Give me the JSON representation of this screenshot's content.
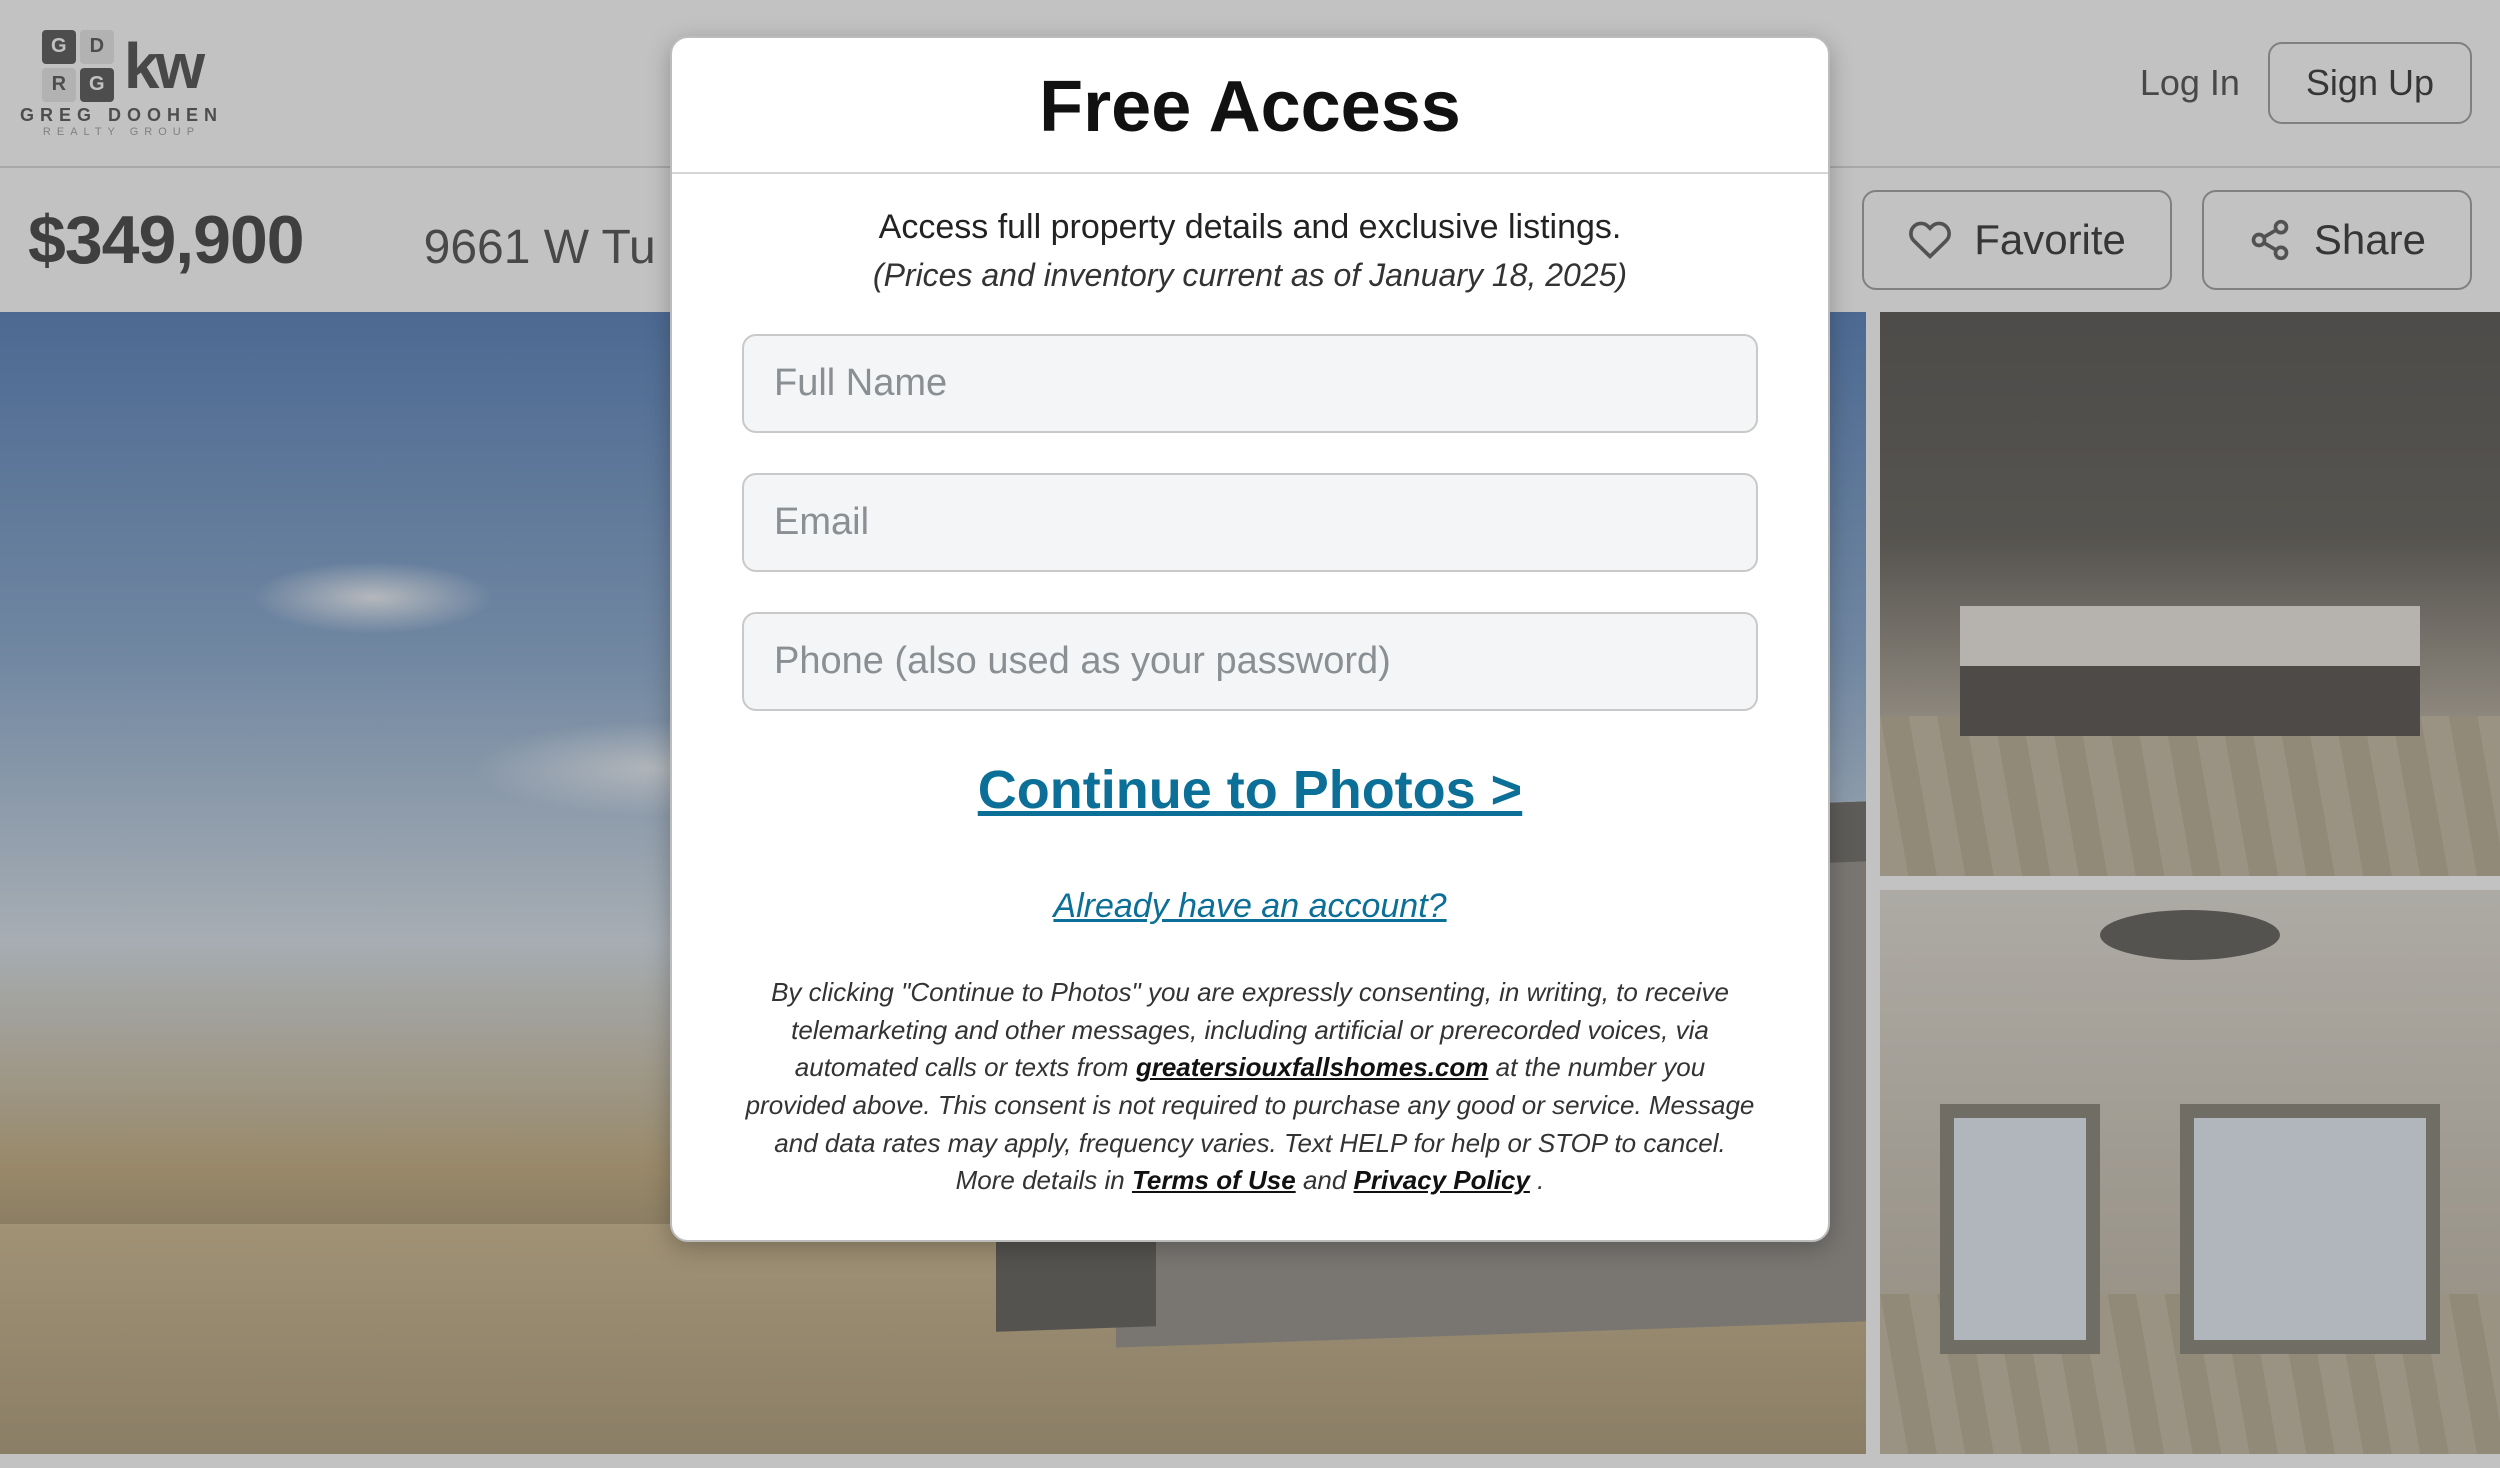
{
  "header": {
    "logo": {
      "squares": [
        "G",
        "D",
        "R",
        "G"
      ],
      "brand": "kw",
      "line1": "GREG DOOHEN",
      "line2": "REALTY GROUP"
    },
    "login_label": "Log In",
    "signup_label": "Sign Up"
  },
  "property": {
    "price": "$349,900",
    "address": "9661 W Tu",
    "favorite_label": "Favorite",
    "share_label": "Share"
  },
  "modal": {
    "title": "Free Access",
    "lead": "Access full property details and exclusive listings.",
    "sub": "(Prices and inventory current as of January 18, 2025)",
    "fullname_placeholder": "Full Name",
    "email_placeholder": "Email",
    "phone_placeholder": "Phone (also used as your password)",
    "cta_label": "Continue to Photos >",
    "alt_link_label": "Already have an account?",
    "legal_pre": "By clicking \"Continue to Photos\" you are expressly consenting, in writing, to receive telemarketing and other messages, including artificial or prerecorded voices, via automated calls or texts from ",
    "legal_domain": "greatersiouxfallshomes.com",
    "legal_mid": " at the number you provided above. This consent is not required to purchase any good or service. Message and data rates may apply, frequency varies. Text HELP for help or STOP to cancel. More details in ",
    "legal_terms": "Terms of Use",
    "legal_and": " and ",
    "legal_privacy": "Privacy Policy",
    "legal_end": "."
  }
}
